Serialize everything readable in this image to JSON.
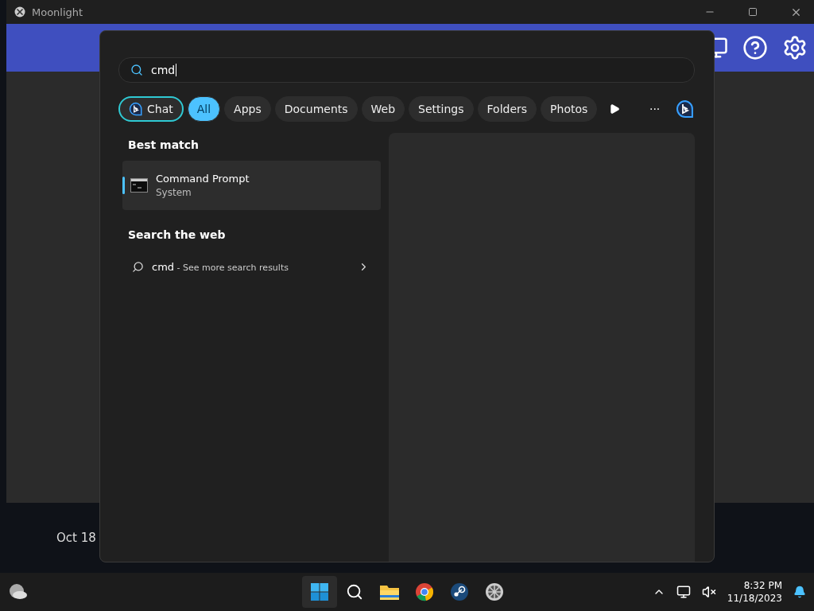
{
  "window": {
    "title": "Moonlight"
  },
  "background": {
    "date": "Oct 18"
  },
  "search_flyout": {
    "query": "cmd",
    "filters": [
      {
        "label": "Chat",
        "kind": "chat",
        "selected": false
      },
      {
        "label": "All",
        "kind": "chip",
        "selected": true
      },
      {
        "label": "Apps",
        "kind": "chip",
        "selected": false
      },
      {
        "label": "Documents",
        "kind": "chip",
        "selected": false
      },
      {
        "label": "Web",
        "kind": "chip",
        "selected": false
      },
      {
        "label": "Settings",
        "kind": "chip",
        "selected": false
      },
      {
        "label": "Folders",
        "kind": "chip",
        "selected": false
      },
      {
        "label": "Photos",
        "kind": "chip",
        "selected": false
      }
    ],
    "more": "···",
    "best_match": {
      "heading": "Best match",
      "title": "Command Prompt",
      "subtitle": "System",
      "selected": true
    },
    "web": {
      "heading": "Search the web",
      "query": "cmd",
      "suffix": " - See more search results"
    }
  },
  "taskbar": {
    "time": "8:32 PM",
    "date": "11/18/2023"
  }
}
